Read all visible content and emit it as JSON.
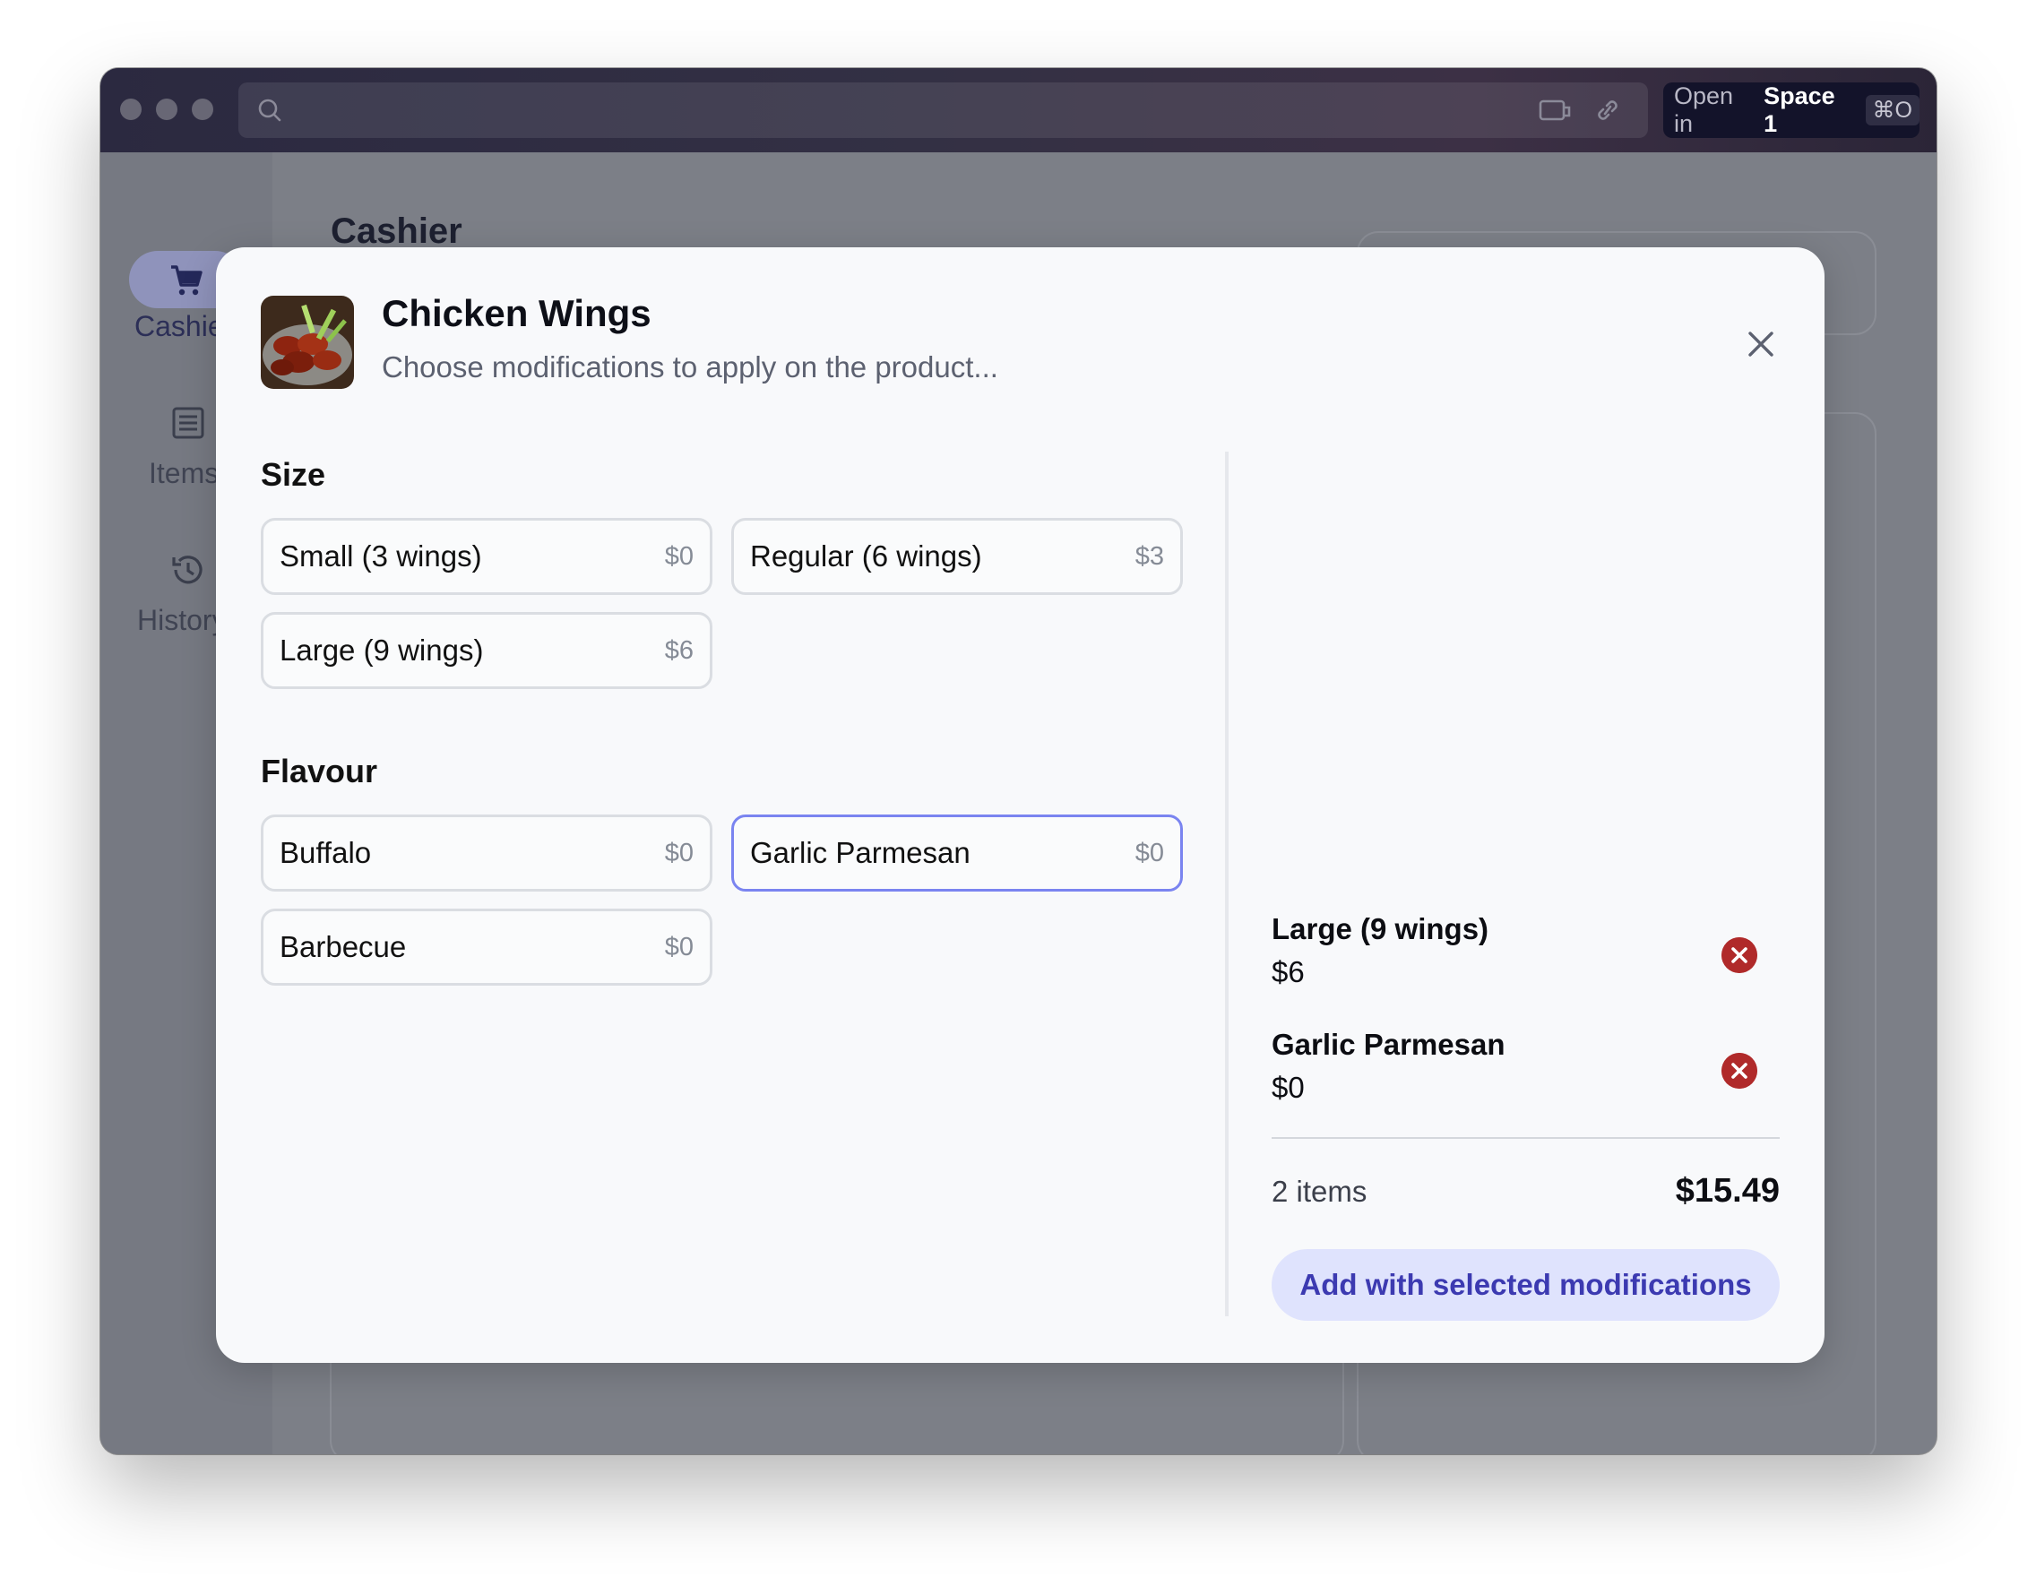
{
  "browser": {
    "open_in_prefix": "Open in",
    "open_in_space": "Space 1",
    "open_in_shortcut": "⌘O"
  },
  "sidebar": {
    "items": [
      {
        "label": "Cashier",
        "icon": "cart-icon",
        "active": true
      },
      {
        "label": "Items",
        "icon": "list-icon",
        "active": false
      },
      {
        "label": "History",
        "icon": "history-icon",
        "active": false
      }
    ]
  },
  "page": {
    "title": "Cashier"
  },
  "modal": {
    "title": "Chicken Wings",
    "subtitle": "Choose modifications to apply on the product...",
    "sections": [
      {
        "title": "Size",
        "options": [
          {
            "label": "Small (3 wings)",
            "price": "$0",
            "selected": false
          },
          {
            "label": "Regular (6 wings)",
            "price": "$3",
            "selected": false
          },
          {
            "label": "Large (9 wings)",
            "price": "$6",
            "selected": false
          }
        ]
      },
      {
        "title": "Flavour",
        "options": [
          {
            "label": "Buffalo",
            "price": "$0",
            "selected": false
          },
          {
            "label": "Garlic Parmesan",
            "price": "$0",
            "selected": true
          },
          {
            "label": "Barbecue",
            "price": "$0",
            "selected": false
          }
        ]
      }
    ],
    "selected": [
      {
        "name": "Large (9 wings)",
        "price": "$6"
      },
      {
        "name": "Garlic Parmesan",
        "price": "$0"
      }
    ],
    "item_count": "2 items",
    "total": "$15.49",
    "add_button": "Add with selected modifications"
  },
  "colors": {
    "accent": "#7a84f0",
    "button_bg": "#dfe3fd",
    "button_text": "#3c3ab1",
    "remove": "#b02a2a"
  }
}
